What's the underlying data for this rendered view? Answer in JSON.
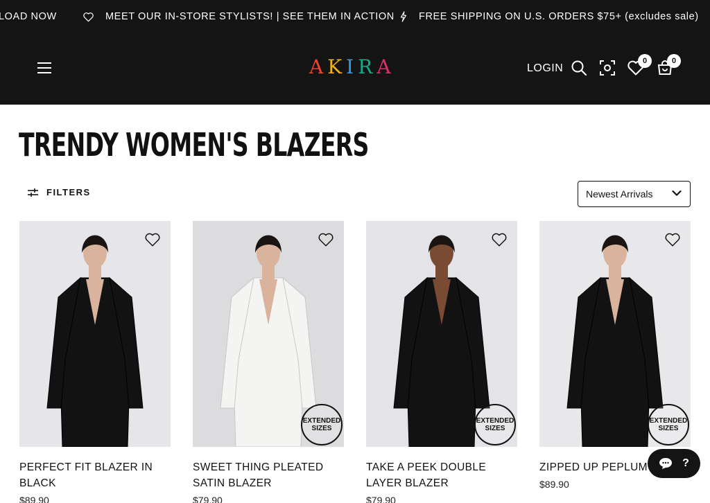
{
  "announcement": {
    "items": [
      {
        "text": "LOAD NOW"
      },
      {
        "text": "MEET OUR IN-STORE STYLISTS! | SEE THEM IN ACTION",
        "icon": "heart-icon"
      },
      {
        "text": "FREE SHIPPING ON U.S. ORDERS $75+ (excludes sale)",
        "icon": "lightning-icon"
      }
    ]
  },
  "header": {
    "logo": [
      "A",
      "K",
      "I",
      "R",
      "A"
    ],
    "logo_colors": [
      "#e8452c",
      "#f2b01e",
      "#3a9ad9",
      "#1aa88a",
      "#d6336c"
    ],
    "login_label": "LOGIN",
    "wishlist_count": "0",
    "cart_count": "0"
  },
  "page": {
    "title": "TRENDY WOMEN'S BLAZERS",
    "filters_label": "FILTERS",
    "sort_value": "Newest Arrivals"
  },
  "products": [
    {
      "name": "PERFECT FIT BLAZER IN BLACK",
      "price": "$89.90",
      "extended_sizes": false,
      "outfit_color": "#121212",
      "bg": "#e6e6ea"
    },
    {
      "name": "SWEET THING PLEATED SATIN BLAZER",
      "price": "$79.90",
      "extended_sizes": true,
      "badge_text": "EXTENDED SIZES",
      "outfit_color": "#f4f4f2",
      "bg": "#dcdcde"
    },
    {
      "name": "TAKE A PEEK DOUBLE LAYER BLAZER",
      "price": "$79.90",
      "extended_sizes": true,
      "badge_text": "EXTENDED SIZES",
      "outfit_color": "#121212",
      "bg": "#e4e4e8"
    },
    {
      "name": "ZIPPED UP PEPLUM B",
      "price": "$89.90",
      "extended_sizes": true,
      "badge_text": "EXTENDED SIZES",
      "outfit_color": "#121212",
      "bg": "#e8e8ea"
    }
  ],
  "chat": {
    "icon": "chat-icon",
    "label": "?"
  }
}
